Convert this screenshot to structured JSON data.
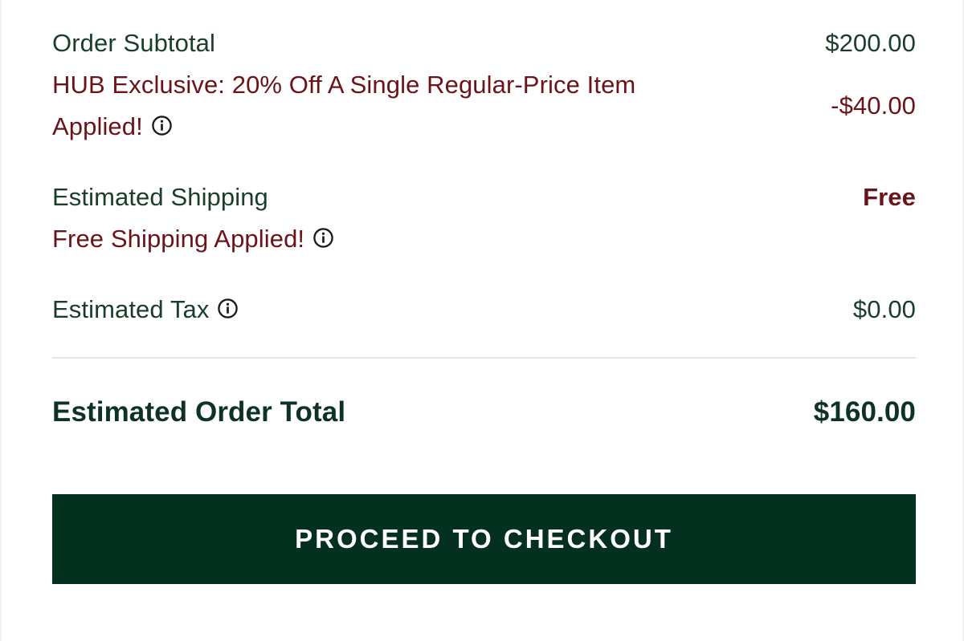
{
  "order_summary": {
    "subtotal": {
      "label": "Order Subtotal",
      "value": "$200.00"
    },
    "discount": {
      "line1": "HUB Exclusive: 20% Off A Single Regular-Price Item",
      "line2": "Applied!",
      "value": "-$40.00",
      "icon": "info-icon"
    },
    "shipping": {
      "label": "Estimated Shipping",
      "value": "Free",
      "note": "Free Shipping Applied!",
      "icon": "info-icon"
    },
    "tax": {
      "label": "Estimated Tax",
      "value": "$0.00",
      "icon": "info-icon"
    },
    "total": {
      "label": "Estimated Order Total",
      "value": "$160.00"
    },
    "checkout_button": {
      "label": "PROCEED TO CHECKOUT"
    }
  },
  "colors": {
    "primary_green": "#1b3d2c",
    "promo_maroon": "#6b1319",
    "button_background": "#03301f",
    "button_text": "#ffffff"
  }
}
